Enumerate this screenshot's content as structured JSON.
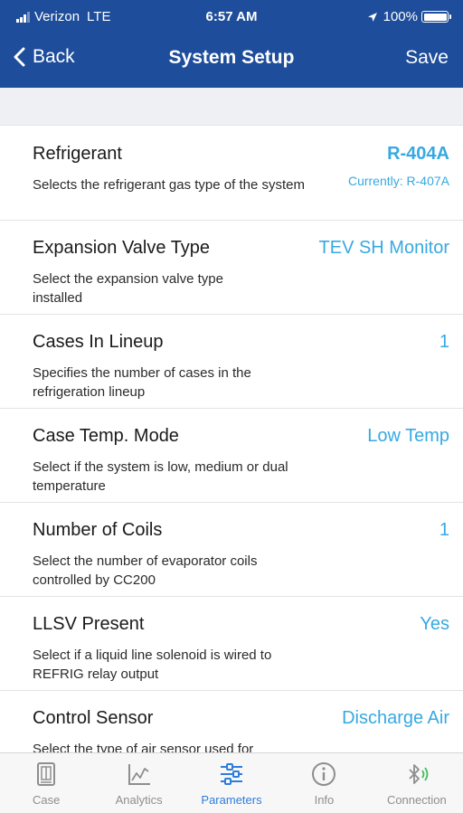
{
  "status_bar": {
    "carrier": "Verizon",
    "network": "LTE",
    "time": "6:57 AM",
    "battery": "100%",
    "battery_level": 1.0
  },
  "nav": {
    "back_label": "Back",
    "title": "System Setup",
    "save_label": "Save"
  },
  "colors": {
    "header_bg": "#1e4d9b",
    "accent": "#37a9e1",
    "active_tab": "#2f7ddb"
  },
  "settings": [
    {
      "title": "Refrigerant",
      "description": "Selects the refrigerant gas type of the system",
      "value": "R-404A",
      "current": "Currently: R-407A"
    },
    {
      "title": "Expansion Valve Type",
      "description": "Select the expansion valve type installed",
      "value": "TEV SH Monitor"
    },
    {
      "title": "Cases In Lineup",
      "description": "Specifies the number of cases in the refrigeration lineup",
      "value": "1"
    },
    {
      "title": "Case Temp. Mode",
      "description": "Select if the system is low, medium or dual temperature",
      "value": "Low Temp"
    },
    {
      "title": "Number of Coils",
      "description": "Select the number of evaporator coils controlled by CC200",
      "value": "1"
    },
    {
      "title": "LLSV Present",
      "description": "Select if a liquid line solenoid is wired to REFRIG relay output",
      "value": "Yes"
    },
    {
      "title": "Control Sensor",
      "description": "Select the type of air sensor used for",
      "value": "Discharge Air"
    }
  ],
  "tabbar": {
    "tabs": [
      {
        "label": "Case",
        "icon": "case-icon",
        "active": false
      },
      {
        "label": "Analytics",
        "icon": "analytics-icon",
        "active": false
      },
      {
        "label": "Parameters",
        "icon": "sliders-icon",
        "active": true
      },
      {
        "label": "Info",
        "icon": "info-icon",
        "active": false
      },
      {
        "label": "Connection",
        "icon": "bluetooth-icon",
        "active": false
      }
    ]
  }
}
